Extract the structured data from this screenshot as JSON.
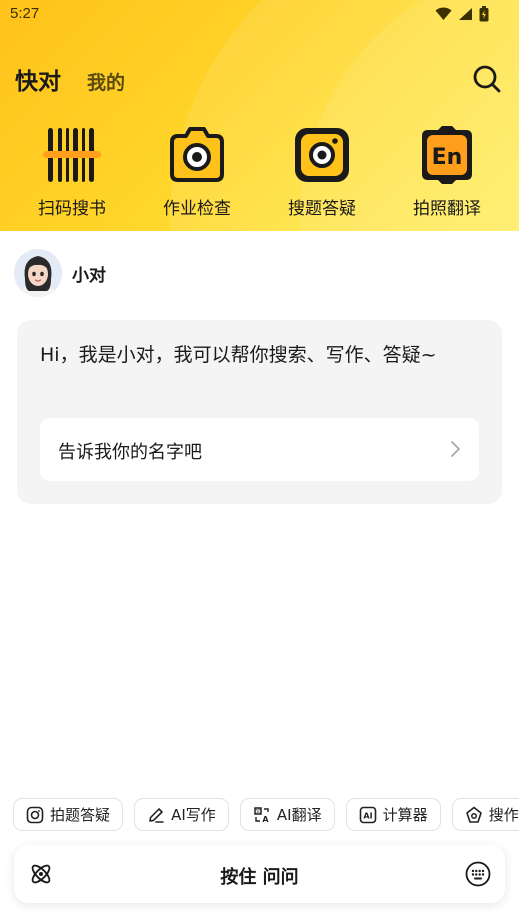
{
  "status_bar": {
    "time": "5:27",
    "icons": [
      "wifi-icon",
      "signal-icon",
      "battery-icon"
    ]
  },
  "tabs": [
    {
      "label": "快对",
      "active": true
    },
    {
      "label": "我的",
      "active": false
    }
  ],
  "tools": [
    {
      "label": "扫码搜书",
      "icon": "barcode-icon"
    },
    {
      "label": "作业检查",
      "icon": "camera-icon"
    },
    {
      "label": "搜题答疑",
      "icon": "camera-square-icon"
    },
    {
      "label": "拍照翻译",
      "icon": "en-translate-icon"
    }
  ],
  "assistant": {
    "name": "小对",
    "avatar": "girl-avatar"
  },
  "message": {
    "text": "Hi，我是小对，我可以帮你搜索、写作、答疑~",
    "suggestion": "告诉我你的名字吧"
  },
  "chips": [
    {
      "label": "拍题答疑",
      "icon": "scan-camera-icon"
    },
    {
      "label": "AI写作",
      "icon": "pen-icon"
    },
    {
      "label": "AI翻译",
      "icon": "translate-icon"
    },
    {
      "label": "计算器",
      "icon": "ai-calculator-icon"
    },
    {
      "label": "搜作文",
      "icon": "search-essay-icon"
    }
  ],
  "voice_bar": {
    "label": "按住 问问",
    "left_icon": "atom-icon",
    "right_icon": "keyboard-icon"
  },
  "colors": {
    "header_start": "#ffc21a",
    "header_end": "#ffec55",
    "accent_orange": "#ff9f1c",
    "bubble_bg": "#f4f4f4"
  }
}
